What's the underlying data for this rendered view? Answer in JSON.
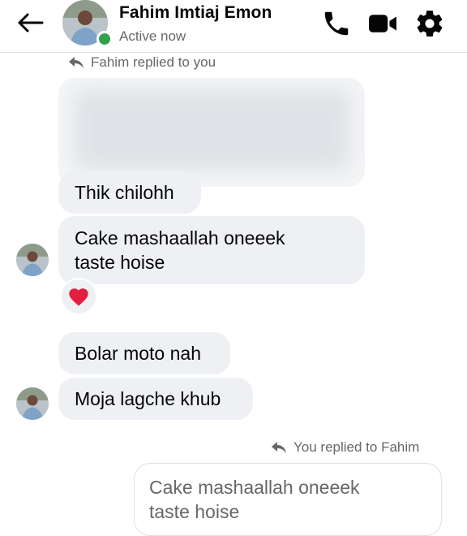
{
  "header": {
    "contact_name": "Fahim Imtiaj Emon",
    "status": "Active now",
    "icons": [
      "back-arrow-icon",
      "phone-icon",
      "video-camera-icon",
      "gear-icon"
    ]
  },
  "replies": {
    "fahim_reply_note": "Fahim replied to you",
    "you_reply_note": "You replied to Fahim"
  },
  "messages": {
    "m1": "Thik chilohh",
    "m2": "Cake mashaallah oneeek\ntaste hoise",
    "m3": "Bolar moto nah",
    "m4": "Moja lagche khub"
  },
  "reaction": {
    "emoji": "❤️",
    "icon": "heart-icon",
    "color": "#e41e3f"
  },
  "outgoing_quote": "Cake mashaallah oneeek\ntaste hoise",
  "colors": {
    "bubble": "#eef0f3",
    "active": "#31a24c",
    "secondary_text": "#65676b"
  }
}
